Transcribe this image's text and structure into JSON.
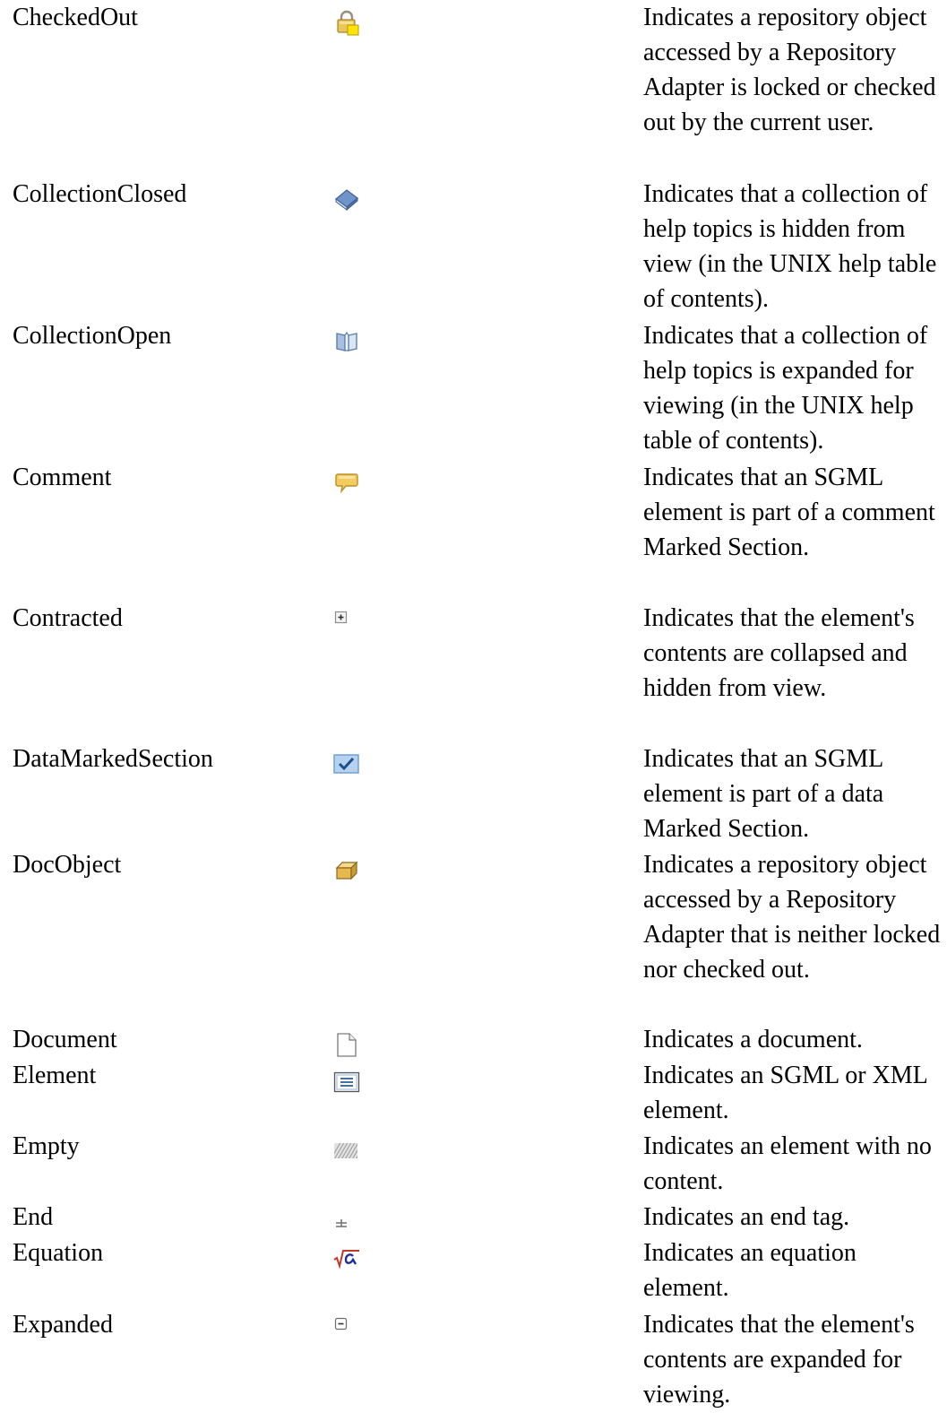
{
  "rows": [
    {
      "name": "CheckedOut",
      "icon": "checked-out-lock-icon",
      "description": "Indicates a repository object accessed by a Repository Adapter is locked or checked out by the current user."
    },
    {
      "name": "CollectionClosed",
      "icon": "collection-closed-book-icon",
      "description": "Indicates that a collection of help topics is hidden from view (in the UNIX help table of contents)."
    },
    {
      "name": "CollectionOpen",
      "icon": "collection-open-book-icon",
      "description": "Indicates that a collection of help topics is expanded for viewing (in the UNIX help table of contents)."
    },
    {
      "name": "Comment",
      "icon": "comment-bubble-icon",
      "description": "Indicates that an SGML element is part of a comment Marked Section."
    },
    {
      "name": "Contracted",
      "icon": "plus-box-icon",
      "description": "Indicates that the element's contents are collapsed and hidden from view."
    },
    {
      "name": "DataMarkedSection",
      "icon": "checkmark-box-icon",
      "description": "Indicates that an SGML element is part of a data Marked Section."
    },
    {
      "name": "DocObject",
      "icon": "doc-object-cube-icon",
      "description": "Indicates a repository object accessed by a Repository Adapter that is neither locked nor checked out."
    },
    {
      "name": "Document",
      "icon": "document-page-icon",
      "description": "Indicates a document."
    },
    {
      "name": "Element",
      "icon": "element-lines-icon",
      "description": "Indicates an SGML or XML element."
    },
    {
      "name": "Empty",
      "icon": "empty-hatched-icon",
      "description": "Indicates an element with no content."
    },
    {
      "name": "End",
      "icon": "end-tag-icon",
      "description": "Indicates an end tag."
    },
    {
      "name": "Equation",
      "icon": "equation-sqrt-alpha-icon",
      "description": "Indicates an equation element."
    },
    {
      "name": "Expanded",
      "icon": "minus-box-icon",
      "description": "Indicates that the element's contents are expanded for viewing."
    }
  ]
}
